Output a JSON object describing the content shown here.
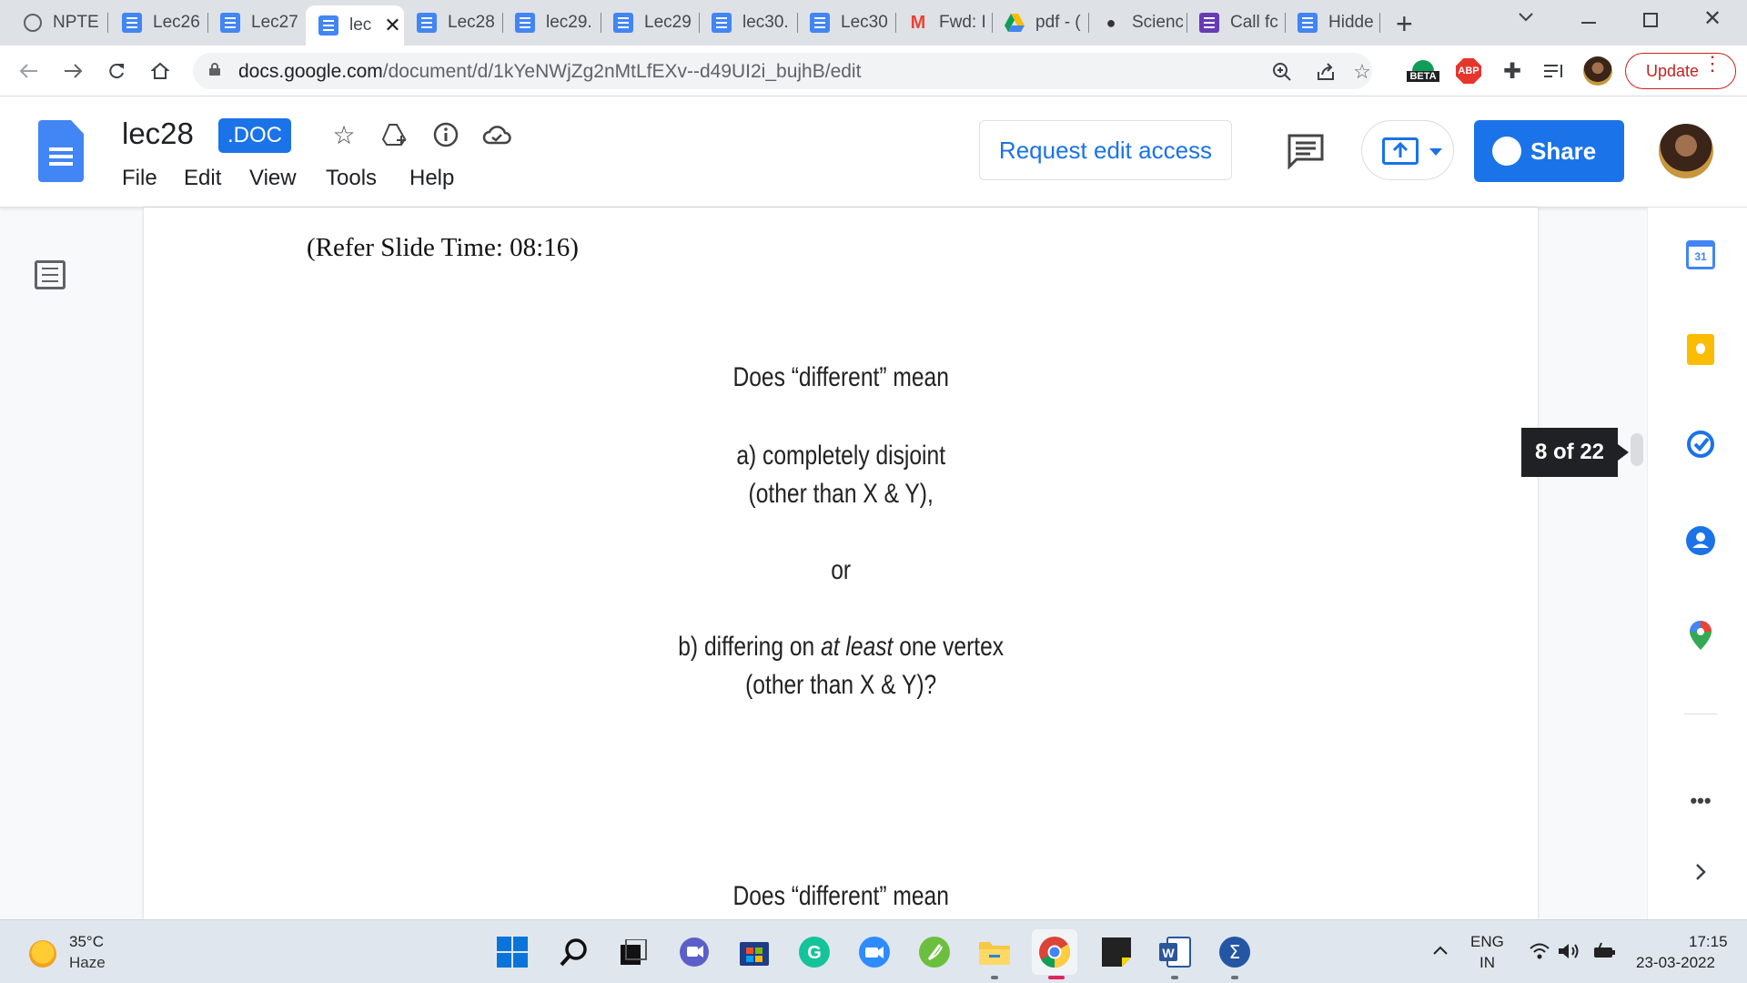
{
  "tabs": [
    {
      "label": "NPTEL",
      "icon": "globe-icon"
    },
    {
      "label": "Lec26",
      "icon": "docs-icon"
    },
    {
      "label": "Lec27",
      "icon": "docs-icon"
    },
    {
      "label": "lec",
      "icon": "docs-icon",
      "active": true
    },
    {
      "label": "Lec28",
      "icon": "docs-icon"
    },
    {
      "label": "lec29.",
      "icon": "docs-icon"
    },
    {
      "label": "Lec29",
      "icon": "docs-icon"
    },
    {
      "label": "lec30.",
      "icon": "docs-icon"
    },
    {
      "label": "Lec30",
      "icon": "docs-icon"
    },
    {
      "label": "Fwd: I",
      "icon": "gmail-icon"
    },
    {
      "label": "pdf - (",
      "icon": "drive-icon"
    },
    {
      "label": "Scienc",
      "icon": "chat-icon"
    },
    {
      "label": "Call fc",
      "icon": "forms-icon"
    },
    {
      "label": "Hidde",
      "icon": "docs-icon"
    }
  ],
  "address_bar": {
    "url_domain": "docs.google.com",
    "url_path": "/document/d/1kYeNWjZg2nMtLfEXv--d49UI2i_bujhB/edit"
  },
  "toolbar": {
    "beta_label": "BETA",
    "abp_label": "ABP",
    "update_label": "Update"
  },
  "doc": {
    "title": "lec28",
    "badge": ".DOC",
    "menu": [
      "File",
      "Edit",
      "View",
      "Tools",
      "Help"
    ],
    "request_edit_label": "Request edit access",
    "share_label": "Share"
  },
  "page": {
    "refer_time": "(Refer Slide Time: 08:16)",
    "question": "Does “different” mean",
    "option_a_line1": "a) completely disjoint",
    "option_a_line2": "(other than X & Y),",
    "or": "or",
    "option_b_pre": "b) differing on ",
    "option_b_em": "at least",
    "option_b_post": " one vertex",
    "option_b_line2": "(other than X & Y)?",
    "question_repeat": "Does “different” mean",
    "page_indicator": "8 of 22"
  },
  "side_panel": {
    "calendar_day": "31"
  },
  "taskbar": {
    "temperature": "35°C",
    "weather": "Haze",
    "lang_line1": "ENG",
    "lang_line2": "IN",
    "time": "17:15",
    "date": "23-03-2022"
  },
  "colors": {
    "accent_blue": "#1a73e8",
    "update_red": "#c5221f",
    "docs_blue": "#4285f4"
  }
}
